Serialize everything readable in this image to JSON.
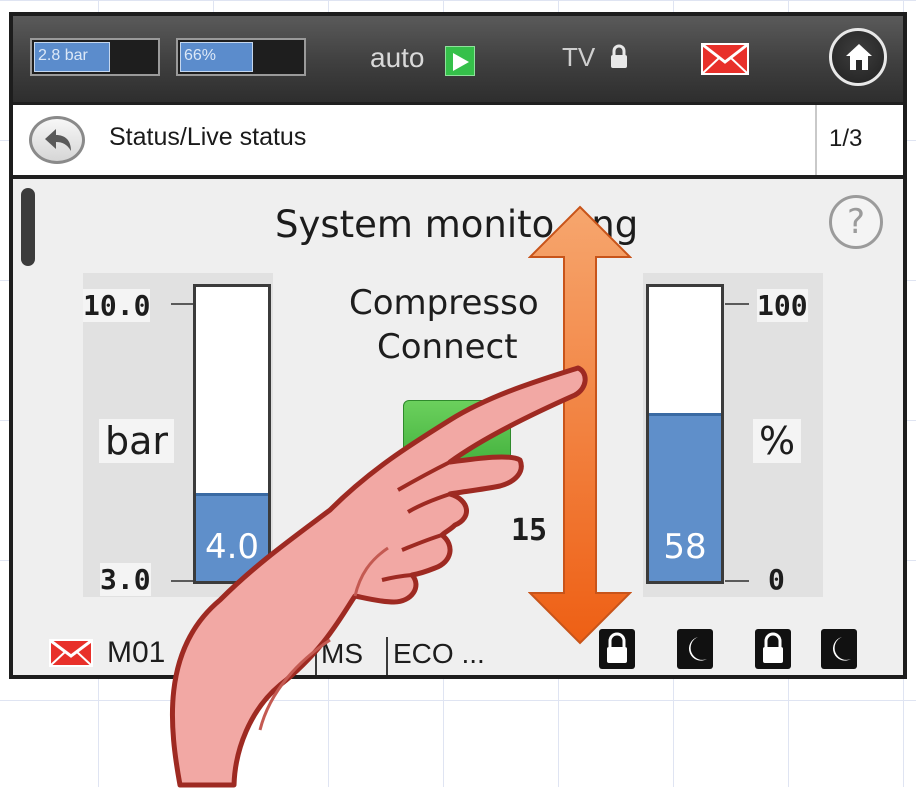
{
  "topbar": {
    "pressure_label": "2.8 bar",
    "pressure_fraction": 0.62,
    "load_label": "66%",
    "load_fraction": 0.6,
    "mode_label": "auto",
    "mode_icon": "play-icon",
    "access_label": "TV",
    "access_icon": "lock-icon",
    "message_icon": "mail-icon",
    "home_icon": "home-icon",
    "colors": {
      "bar_fill": "#5b8ccc",
      "mode_green": "#35c04a",
      "mail_red": "#e8302a"
    }
  },
  "breadcrumb": {
    "back_icon": "back-arrow-icon",
    "path": "Status/Live status",
    "page": "1/3"
  },
  "panel": {
    "title": "System monito ng",
    "help_symbol": "?",
    "compressor_label": "Compresso",
    "connect_label": "Connect",
    "partial_value": "15",
    "left_gauge": {
      "max_label": "10.0",
      "min_label": "3.0",
      "unit": "bar",
      "value_label": "4.0",
      "fill_fraction": 0.3
    },
    "right_gauge": {
      "max_label": "100",
      "min_label": "0",
      "unit": "%",
      "value_label": "58",
      "fill_fraction": 0.57
    },
    "colors": {
      "gauge_fill": "#5f8fca",
      "status_green": "#4cbf44"
    }
  },
  "statusbar": {
    "message_icon": "mail-icon",
    "message_code": "M01",
    "ms_label": "MS",
    "eco_label": "ECO ...",
    "icons": [
      "lock-icon",
      "moon-icon",
      "lock-icon",
      "moon-icon"
    ]
  },
  "overlay": {
    "gesture": "vertical-swipe",
    "arrow_icon": "double-arrow-icon",
    "hand_icon": "pointing-hand-icon",
    "arrow_color": "#f07a2a"
  }
}
